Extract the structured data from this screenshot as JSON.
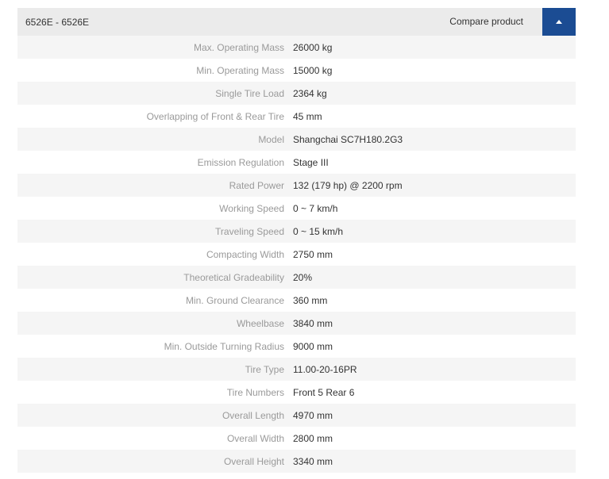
{
  "header": {
    "title": "6526E - 6526E",
    "compare_label": "Compare product",
    "toggle_icon": "caret-up-icon",
    "accent_color": "#1b4c93"
  },
  "specs": [
    {
      "label": "Max. Operating Mass",
      "value": "26000 kg"
    },
    {
      "label": "Min. Operating Mass",
      "value": "15000 kg"
    },
    {
      "label": "Single Tire Load",
      "value": "2364 kg"
    },
    {
      "label": "Overlapping of Front & Rear Tire",
      "value": "45 mm"
    },
    {
      "label": "Model",
      "value": "Shangchai SC7H180.2G3"
    },
    {
      "label": "Emission Regulation",
      "value": "Stage III"
    },
    {
      "label": "Rated Power",
      "value": "132 (179 hp) @ 2200 rpm"
    },
    {
      "label": "Working Speed",
      "value": "0 ~ 7 km/h"
    },
    {
      "label": "Traveling Speed",
      "value": "0 ~ 15 km/h"
    },
    {
      "label": "Compacting Width",
      "value": "2750 mm"
    },
    {
      "label": "Theoretical Gradeability",
      "value": "20%"
    },
    {
      "label": "Min. Ground Clearance",
      "value": "360 mm"
    },
    {
      "label": "Wheelbase",
      "value": "3840 mm"
    },
    {
      "label": "Min. Outside Turning Radius",
      "value": "9000 mm"
    },
    {
      "label": "Tire Type",
      "value": "11.00-20-16PR"
    },
    {
      "label": "Tire Numbers",
      "value": "Front 5 Rear 6"
    },
    {
      "label": "Overall Length",
      "value": "4970 mm"
    },
    {
      "label": "Overall Width",
      "value": "2800 mm"
    },
    {
      "label": "Overall Height",
      "value": "3340 mm"
    }
  ]
}
